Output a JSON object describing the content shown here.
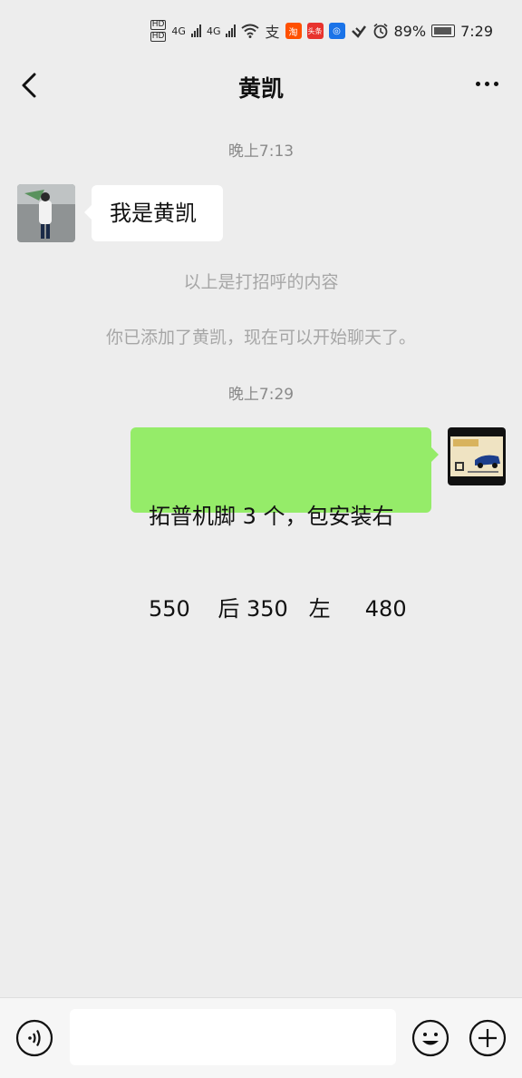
{
  "status_bar": {
    "hd1": "HD",
    "hd2": "HD",
    "net1": "4G",
    "net2": "4G",
    "battery_percent": "89%",
    "time": "7:29",
    "app_badges": [
      "支",
      "淘",
      "头条",
      "◎"
    ]
  },
  "header": {
    "title": "黄凯"
  },
  "messages": {
    "ts1": "晚上7:13",
    "incoming_text": "我是黄凯",
    "sys1": "以上是打招呼的内容",
    "sys2": "你已添加了黄凯，现在可以开始聊天了。",
    "ts2": "晚上7:29",
    "outgoing_line1": "拓普机脚 3 个，包安装右",
    "outgoing_line2": "550    后 350   左     480"
  },
  "composer": {
    "placeholder": ""
  },
  "colors": {
    "background": "#ededed",
    "outgoing_bubble": "#95ec69",
    "incoming_bubble": "#ffffff"
  }
}
